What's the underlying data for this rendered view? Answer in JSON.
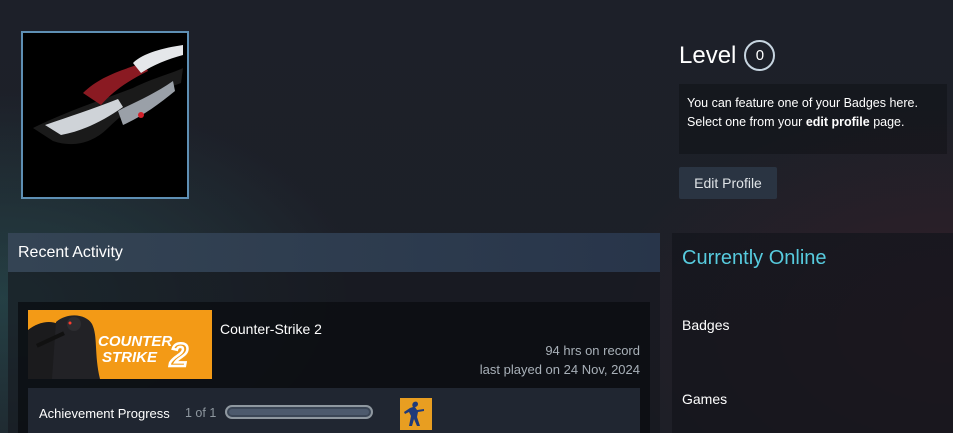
{
  "profile": {
    "level_label": "Level",
    "level_value": "0",
    "badge_text_1": "You can feature one of your Badges here.",
    "badge_text_2_pre": "Select one from your ",
    "badge_text_2_link": "edit profile",
    "badge_text_2_post": " page.",
    "edit_button": "Edit Profile"
  },
  "recent_activity": {
    "title": "Recent Activity",
    "game": {
      "name": "Counter-Strike 2",
      "logo_line1": "COUNTER",
      "logo_line2": "STRIKE",
      "logo_num": "2",
      "hours": "94 hrs on record",
      "last_played": "last played on 24 Nov, 2024",
      "achievement_label": "Achievement Progress",
      "achievement_count": "1 of 1",
      "achievement_fraction": 1.0
    }
  },
  "sidebar": {
    "status": "Currently Online",
    "badges_label": "Badges",
    "games_label": "Games"
  },
  "colors": {
    "accent_online": "#57cbde",
    "header_bg": "#344454",
    "game_capsule": "#f39a16"
  }
}
